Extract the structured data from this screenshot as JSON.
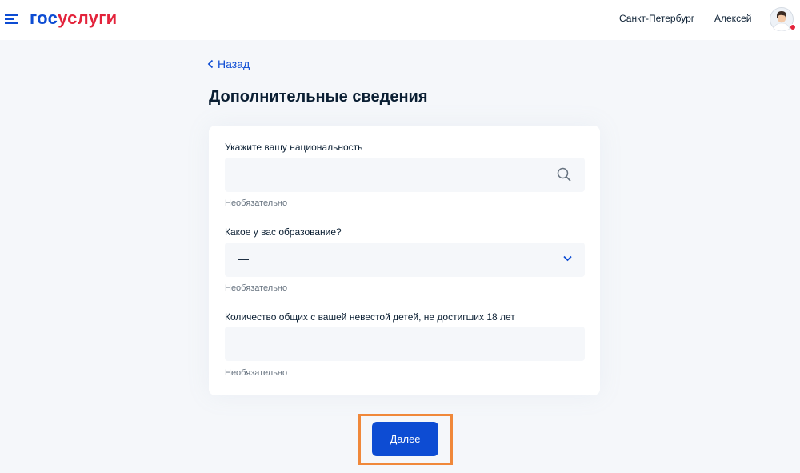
{
  "header": {
    "logo_gos": "гос",
    "logo_uslugi": "услуги",
    "city": "Санкт-Петербург",
    "user_name": "Алексей",
    "menu_icon": "hamburger-icon",
    "avatar_icon": "user-avatar",
    "notification_color": "#e3233b"
  },
  "nav": {
    "back_label": "Назад"
  },
  "page": {
    "title": "Дополнительные сведения"
  },
  "form": {
    "fields": [
      {
        "label": "Укажите вашу национальность",
        "value": "",
        "hint": "Необязательно",
        "icon": "search-icon"
      },
      {
        "label": "Какое у вас образование?",
        "value": "—",
        "hint": "Необязательно",
        "icon": "chevron-down-icon"
      },
      {
        "label": "Количество общих с вашей невестой детей, не достигших 18 лет",
        "value": "",
        "hint": "Необязательно"
      }
    ],
    "next_label": "Далее"
  },
  "colors": {
    "primary": "#0d4cd3",
    "brand_red": "#e3233b",
    "highlight": "#f0883a",
    "background": "#f5f7fa"
  }
}
